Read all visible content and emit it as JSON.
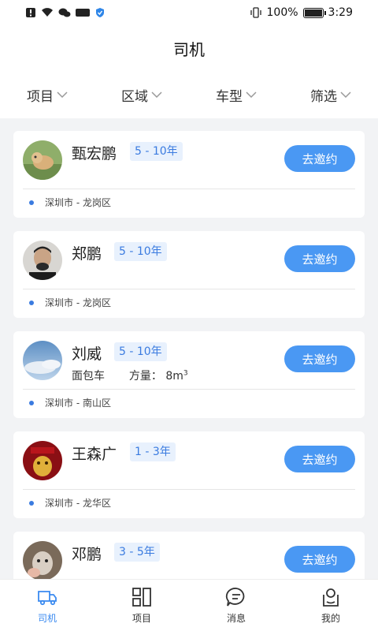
{
  "status": {
    "battery": "100%",
    "time": "3:29"
  },
  "header": {
    "title": "司机"
  },
  "filters": [
    {
      "label": "项目"
    },
    {
      "label": "区域"
    },
    {
      "label": "车型"
    },
    {
      "label": "筛选"
    }
  ],
  "drivers": [
    {
      "name": "甄宏鹏",
      "experience": "5 - 10年",
      "location": "深圳市 - 龙岗区",
      "invite_label": "去邀约"
    },
    {
      "name": "郑鹏",
      "experience": "5 - 10年",
      "location": "深圳市 - 龙岗区",
      "invite_label": "去邀约"
    },
    {
      "name": "刘威",
      "experience": "5 - 10年",
      "vehicle": "面包车",
      "capacity_label": "方量：",
      "capacity": "8m",
      "capacity_unit_sup": "3",
      "location": "深圳市 - 南山区",
      "invite_label": "去邀约"
    },
    {
      "name": "王森广",
      "experience": "1 - 3年",
      "location": "深圳市 - 龙华区",
      "invite_label": "去邀约"
    },
    {
      "name": "邓鹏",
      "experience": "3 - 5年",
      "invite_label": "去邀约"
    }
  ],
  "tabbar": [
    {
      "label": "司机",
      "icon": "truck-icon",
      "active": true
    },
    {
      "label": "项目",
      "icon": "grid-icon",
      "active": false
    },
    {
      "label": "消息",
      "icon": "message-icon",
      "active": false
    },
    {
      "label": "我的",
      "icon": "profile-icon",
      "active": false
    }
  ],
  "colors": {
    "accent": "#4a98f3",
    "tag_bg": "#e8f1fd",
    "tag_text": "#3a7be0"
  }
}
